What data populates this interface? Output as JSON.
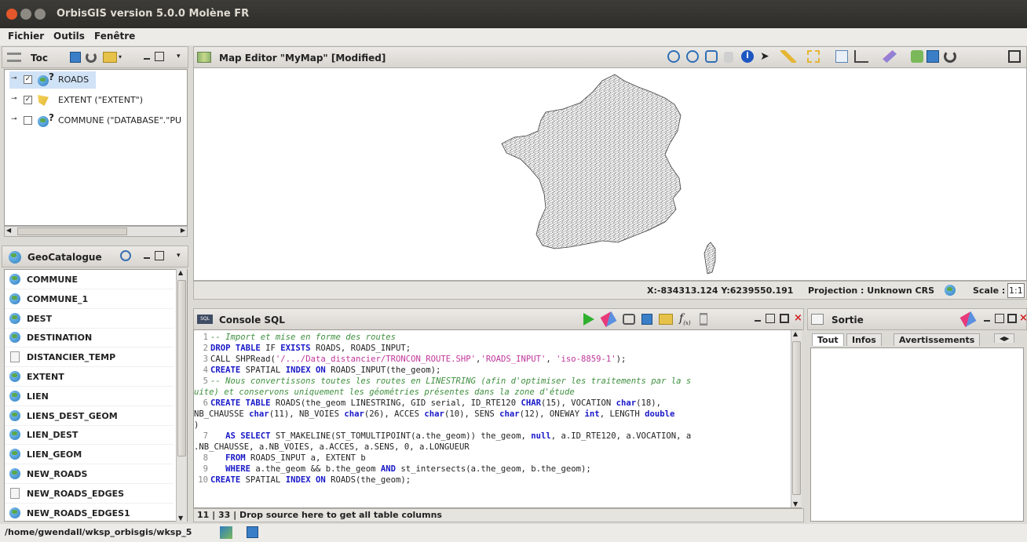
{
  "window": {
    "title": "OrbisGIS version 5.0.0 Molène FR"
  },
  "menu": {
    "items": [
      "Fichier",
      "Outils",
      "Fenêtre"
    ]
  },
  "toc": {
    "title": "Toc",
    "layers": [
      {
        "label": "ROADS",
        "checked": true
      },
      {
        "label": "EXTENT (\"EXTENT\")",
        "checked": true
      },
      {
        "label": "COMMUNE (\"DATABASE\".\"PU",
        "checked": false
      }
    ]
  },
  "geocatalogue": {
    "title": "GeoCatalogue",
    "items": [
      {
        "label": "COMMUNE",
        "kind": "spatial"
      },
      {
        "label": "COMMUNE_1",
        "kind": "spatial"
      },
      {
        "label": "DEST",
        "kind": "spatial"
      },
      {
        "label": "DESTINATION",
        "kind": "spatial"
      },
      {
        "label": "DISTANCIER_TEMP",
        "kind": "table"
      },
      {
        "label": "EXTENT",
        "kind": "spatial"
      },
      {
        "label": "LIEN",
        "kind": "spatial"
      },
      {
        "label": "LIENS_DEST_GEOM",
        "kind": "spatial"
      },
      {
        "label": "LIEN_DEST",
        "kind": "spatial"
      },
      {
        "label": "LIEN_GEOM",
        "kind": "spatial"
      },
      {
        "label": "NEW_ROADS",
        "kind": "spatial"
      },
      {
        "label": "NEW_ROADS_EDGES",
        "kind": "table"
      },
      {
        "label": "NEW_ROADS_EDGES1",
        "kind": "spatial"
      }
    ]
  },
  "map_editor": {
    "title": "Map Editor \"MyMap\" [Modified]",
    "coords": "X:-834313.124 Y:6239550.191",
    "projection": "Projection : Unknown CRS",
    "scale_label": "Scale :",
    "scale_value": "1:1"
  },
  "console": {
    "title": "Console SQL",
    "status": "11 | 33 | Drop source here to get all table columns"
  },
  "sortie": {
    "title": "Sortie",
    "tabs": [
      "Tout",
      "Infos",
      "Avertissements"
    ]
  },
  "footer": {
    "path": "/home/gwendall/wksp_orbisgis/wksp_5"
  },
  "colors": {
    "titlebar": "#3d3c38",
    "close": "#e4572b",
    "panel": "#dcdad5"
  }
}
